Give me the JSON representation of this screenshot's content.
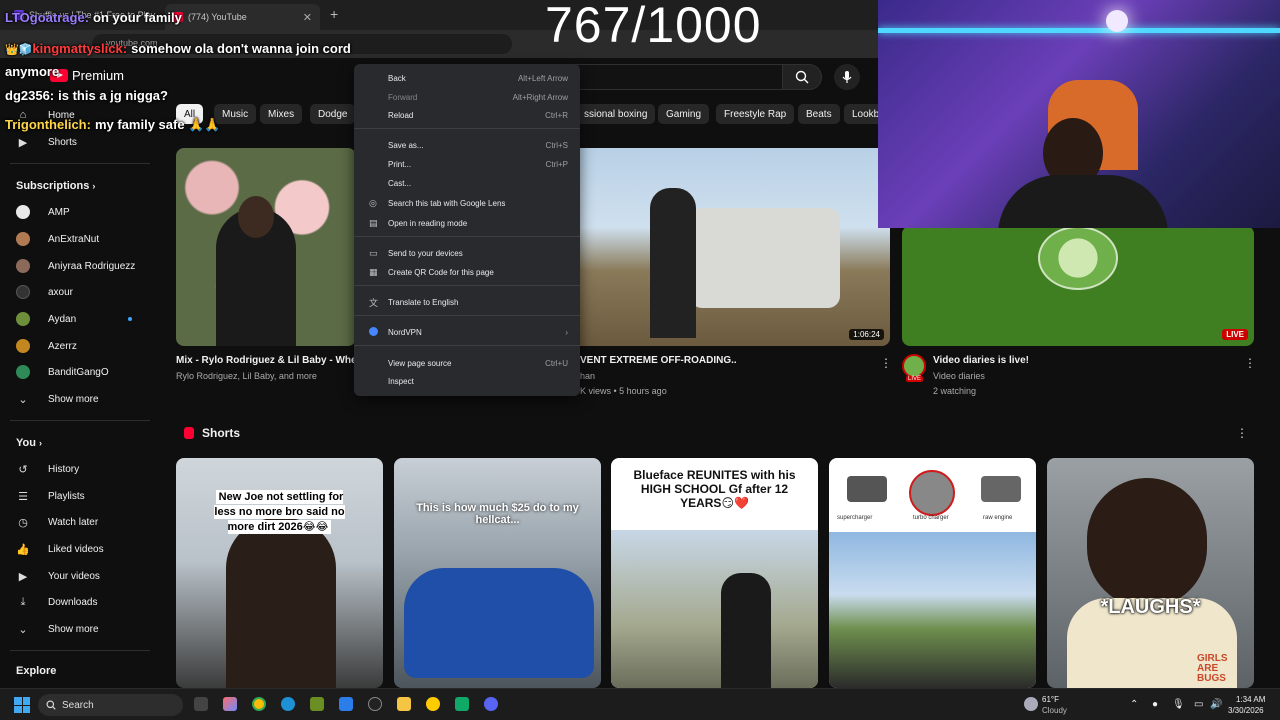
{
  "browser": {
    "tab1_title": "Shuffle.us | The #1 Free to Play",
    "tab2_title": "(774) YouTube",
    "url": "youtube.com"
  },
  "youtube": {
    "logo_text": "Premium"
  },
  "chips": [
    "All",
    "Music",
    "Mixes",
    "Dodge",
    "ssional boxing",
    "Gaming",
    "Freestyle Rap",
    "Beats",
    "Lookb"
  ],
  "sidebar": {
    "top": [
      {
        "label": "Home",
        "icon": "home-icon"
      },
      {
        "label": "Shorts",
        "icon": "shorts-icon"
      }
    ],
    "subscriptions_header": "Subscriptions",
    "subscriptions": [
      {
        "label": "AMP",
        "color": "#e8e8e8"
      },
      {
        "label": "AnExtraNut",
        "color": "#b07a52"
      },
      {
        "label": "Aniyraa Rodriguezz",
        "color": "#8b6a5a"
      },
      {
        "label": "axour",
        "color": "#333333"
      },
      {
        "label": "Aydan",
        "color": "#6d8f3a"
      },
      {
        "label": "Azerrz",
        "color": "#c2871f"
      },
      {
        "label": "BanditGangO",
        "color": "#2e8b57"
      }
    ],
    "show_more": "Show more",
    "you_header": "You",
    "you_items": [
      {
        "label": "History",
        "icon": "history-icon",
        "glyph": "↺"
      },
      {
        "label": "Playlists",
        "icon": "playlists-icon",
        "glyph": "☰"
      },
      {
        "label": "Watch later",
        "icon": "clock-icon",
        "glyph": "◷"
      },
      {
        "label": "Liked videos",
        "icon": "thumbs-up-icon",
        "glyph": "👍"
      },
      {
        "label": "Your videos",
        "icon": "play-square-icon",
        "glyph": "▶"
      },
      {
        "label": "Downloads",
        "icon": "download-icon",
        "glyph": "⤓"
      }
    ],
    "show_more_2": "Show more",
    "explore_header": "Explore"
  },
  "videos": [
    {
      "title": "Mix - Rylo Rodriguez & Lil Baby - Whe",
      "meta": "Rylo Rodriguez, Lil Baby, and more"
    },
    {
      "title": "VENT EXTREME OFF-ROADING..",
      "channel": "han",
      "meta": "K views • 5 hours ago",
      "duration": "1:06:24"
    },
    {
      "title": "Video diaries is live!",
      "channel": "Video diaries",
      "meta": "2 watching",
      "live": "LIVE",
      "avatar_badge": "LIVE"
    }
  ],
  "shorts": {
    "title": "Shorts",
    "items": [
      {
        "caption": "New Joe not settling for less no more bro said no more dirt 2026😂😂"
      },
      {
        "caption": "This is how much $25 do to my hellcat..."
      },
      {
        "caption": "Blueface REUNITES with his HIGH SCHOOL Gf after 12 YEARS😏❤️"
      },
      {
        "labels": [
          "supercharger",
          "turbo charger",
          "raw engine"
        ]
      },
      {
        "caption": "*LAUGHS*",
        "shirt": "GIRLS ARE BUGS"
      }
    ]
  },
  "context_menu": [
    {
      "label": "Back",
      "shortcut": "Alt+Left Arrow"
    },
    {
      "label": "Forward",
      "shortcut": "Alt+Right Arrow",
      "disabled": true
    },
    {
      "label": "Reload",
      "shortcut": "Ctrl+R"
    },
    {
      "label": "Save as...",
      "shortcut": "Ctrl+S"
    },
    {
      "label": "Print...",
      "shortcut": "Ctrl+P"
    },
    {
      "label": "Cast..."
    },
    {
      "label": "Search this tab with Google Lens",
      "icon": "lens-icon"
    },
    {
      "label": "Open in reading mode",
      "icon": "reading-mode-icon"
    },
    {
      "label": "Send to your devices",
      "icon": "devices-icon"
    },
    {
      "label": "Create QR Code for this page",
      "icon": "qr-code-icon"
    },
    {
      "label": "Translate to English",
      "icon": "translate-icon"
    },
    {
      "label": "NordVPN",
      "icon": "nordvpn-icon"
    },
    {
      "label": "View page source",
      "shortcut": "Ctrl+U"
    },
    {
      "label": "Inspect"
    }
  ],
  "overlay": {
    "counter": "767/1000",
    "chat": [
      {
        "user": "LTOgoatrage:",
        "user_color": "#9b7cff",
        "text": "on your family"
      },
      {
        "user": "kingmattyslick:",
        "user_color": "#ff3b3b",
        "text": "somehow ola don't wanna join cord anymore"
      },
      {
        "user": "dg2356:",
        "user_color": "#ffffff",
        "text": "is this a jg nigga?"
      },
      {
        "user": "Trigonthelich:",
        "user_color": "#ffd54a",
        "text": "my family safe 🙏🙏"
      }
    ]
  },
  "taskbar": {
    "search": "Search",
    "weather_temp": "61°F",
    "weather_desc": "Cloudy",
    "time": "1:34 AM",
    "date": "3/30/2026"
  }
}
